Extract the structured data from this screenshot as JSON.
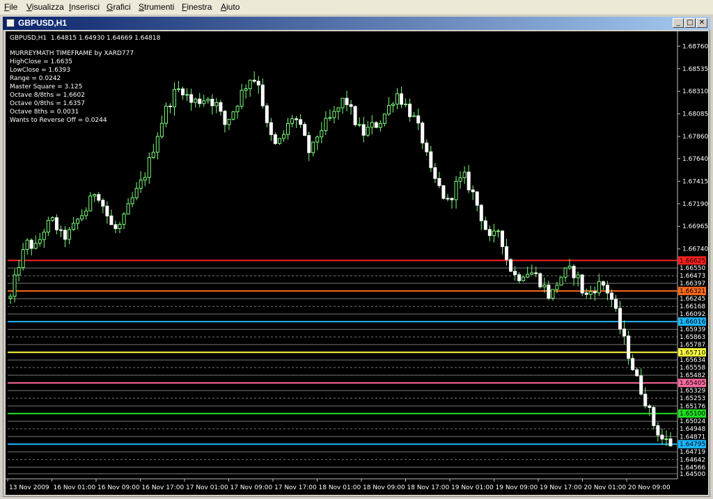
{
  "menu": {
    "items": [
      "File",
      "Visualizza",
      "Inserisci",
      "Grafici",
      "Strumenti",
      "Finestra",
      "Aiuto"
    ]
  },
  "window": {
    "title": "GBPUSD,H1",
    "minimize": "_",
    "restore": "□",
    "close": "✕"
  },
  "chart": {
    "header": "GBPUSD,H1  1.64815 1.64930 1.64669 1.64818",
    "info_lines": [
      "MURREYMATH TIMEFRAME by XARD777",
      "HighClose = 1.6635",
      "LowClose = 1.6393",
      "Range = 0.0242",
      "Master Square = 3.125",
      "Octave 8/8ths = 1.6602",
      "Octave 0/8ths = 1.6357",
      "Octave 8ths = 0.0031",
      "Wants to Reverse Off = 0.0244"
    ]
  },
  "chart_data": {
    "type": "candlestick",
    "symbol": "GBPUSD",
    "timeframe": "H1",
    "ylim": [
      1.6445,
      1.6888
    ],
    "y_ticks": [
      "1.68760",
      "1.68535",
      "1.68310",
      "1.68085",
      "1.67860",
      "1.67640",
      "1.67415",
      "1.67190",
      "1.66965",
      "1.66740"
    ],
    "level_labels": [
      "1.66550",
      "1.66473",
      "1.66397",
      "1.66245",
      "1.66168",
      "1.66092",
      "1.65939",
      "1.65863",
      "1.65787",
      "1.65634",
      "1.65558",
      "1.65482",
      "1.65329",
      "1.65253",
      "1.65176",
      "1.65024",
      "1.64948",
      "1.64871",
      "1.64719",
      "1.64642",
      "1.64566",
      "1.64500"
    ],
    "x_labels": [
      "13 Nov 2009",
      "16 Nov 01:00",
      "16 Nov 09:00",
      "16 Nov 17:00",
      "17 Nov 01:00",
      "17 Nov 09:00",
      "17 Nov 17:00",
      "18 Nov 01:00",
      "18 Nov 09:00",
      "18 Nov 17:00",
      "19 Nov 01:00",
      "19 Nov 09:00",
      "19 Nov 17:00",
      "20 Nov 01:00",
      "20 Nov 09:00"
    ],
    "colored_levels": [
      {
        "value": "1.66625",
        "color": "#ff2020"
      },
      {
        "value": "1.66321",
        "color": "#ff6a1a"
      },
      {
        "value": "1.66016",
        "color": "#1ab8ff"
      },
      {
        "value": "1.65710",
        "color": "#ffff40"
      },
      {
        "value": "1.65405",
        "color": "#ff6aa0"
      },
      {
        "value": "1.65100",
        "color": "#20e020"
      },
      {
        "value": "1.64795",
        "color": "#1ab8ff"
      }
    ],
    "close_path": [
      1.6625,
      1.666,
      1.668,
      1.6675,
      1.6695,
      1.6702,
      1.6685,
      1.669,
      1.6705,
      1.6715,
      1.6735,
      1.6713,
      1.6692,
      1.6698,
      1.672,
      1.6735,
      1.6755,
      1.6785,
      1.681,
      1.6828,
      1.6835,
      1.682,
      1.6822,
      1.6825,
      1.6818,
      1.6798,
      1.6812,
      1.683,
      1.6845,
      1.684,
      1.6792,
      1.6775,
      1.679,
      1.6808,
      1.679,
      1.6767,
      1.6792,
      1.68,
      1.681,
      1.6825,
      1.6805,
      1.6788,
      1.6795,
      1.68,
      1.6813,
      1.683,
      1.6818,
      1.6805,
      1.6785,
      1.675,
      1.6735,
      1.672,
      1.6738,
      1.6745,
      1.6728,
      1.6705,
      1.668,
      1.6695,
      1.666,
      1.6645,
      1.6652,
      1.665,
      1.664,
      1.6625,
      1.6645,
      1.6652,
      1.665,
      1.6625,
      1.6635,
      1.664,
      1.6628,
      1.6598,
      1.6572,
      1.6545,
      1.6525,
      1.65,
      1.6485,
      1.648
    ]
  }
}
